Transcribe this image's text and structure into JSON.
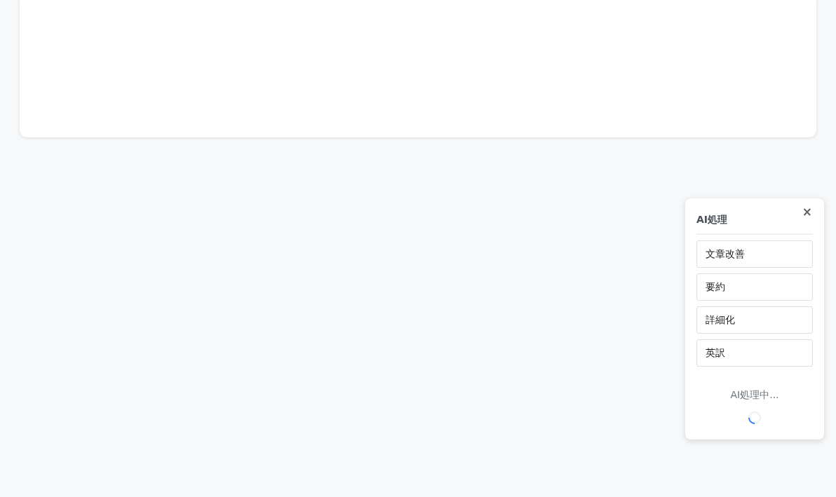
{
  "panel": {
    "title": "AI処理",
    "close": "×",
    "actions": [
      {
        "label": "文章改善"
      },
      {
        "label": "要約"
      },
      {
        "label": "詳細化"
      },
      {
        "label": "英訳"
      }
    ],
    "status": "AI処理中..."
  }
}
